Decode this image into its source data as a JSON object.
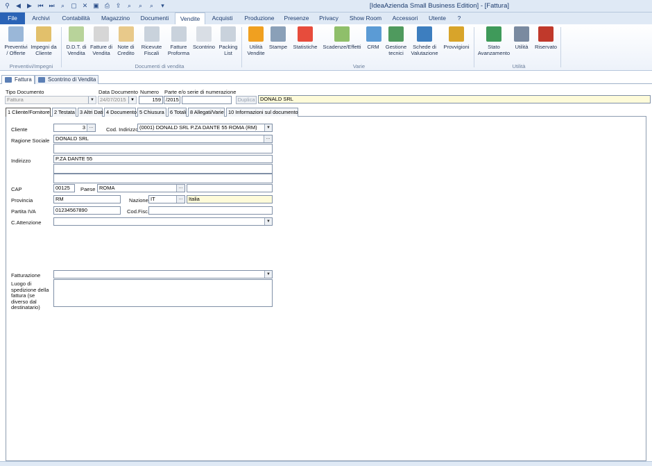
{
  "window": {
    "title": "[IdeaAzienda Small Business Edition] - [Fattura]"
  },
  "quick_access": [
    "binoculars-icon",
    "back-icon",
    "forward-icon",
    "first-icon",
    "last-icon",
    "search-icon",
    "new-icon",
    "delete-icon",
    "save-icon",
    "print-icon",
    "export-icon",
    "find-icon",
    "find-next-icon",
    "find-prev-icon",
    "customize-icon"
  ],
  "ribbon_tabs": [
    "File",
    "Archivi",
    "Contabilità",
    "Magazzino",
    "Documenti",
    "Vendite",
    "Acquisti",
    "Produzione",
    "Presenze",
    "Privacy",
    "Show Room",
    "Accessori",
    "Utente",
    "?"
  ],
  "ribbon": {
    "buttons": [
      {
        "label": "Preventivi\n/ Offerte",
        "icon": "quote-icon",
        "color": "#9ab7d8"
      },
      {
        "label": "Impegni da\nCliente",
        "icon": "commitment-icon",
        "color": "#e2c06b"
      },
      {
        "label": "D.D.T. di\nVendita",
        "icon": "delivery-note-icon",
        "color": "#b8d39a"
      },
      {
        "label": "Fatture di\nVendita",
        "icon": "invoice-icon",
        "color": "#d6d6d6"
      },
      {
        "label": "Note di\nCredito",
        "icon": "credit-note-icon",
        "color": "#e8c98a"
      },
      {
        "label": "Ricevute\nFiscali",
        "icon": "receipt-icon",
        "color": "#c9d2dc"
      },
      {
        "label": "Fatture\nProforma",
        "icon": "proforma-icon",
        "color": "#c9d2dc"
      },
      {
        "label": "Scontrino",
        "icon": "cash-receipt-icon",
        "color": "#d9dee5"
      },
      {
        "label": "Packing\nList",
        "icon": "packing-list-icon",
        "color": "#c9d2dc"
      },
      {
        "label": "Utilità\nVendite",
        "icon": "sales-tools-icon",
        "color": "#f0a020"
      },
      {
        "label": "Stampe",
        "icon": "printer-icon",
        "color": "#8aa0b8"
      },
      {
        "label": "Statistiche",
        "icon": "statistics-icon",
        "color": "#e74c3c"
      },
      {
        "label": "Scadenze/Effetti",
        "icon": "deadlines-icon",
        "color": "#8fbf6a"
      },
      {
        "label": "CRM",
        "icon": "crm-icon",
        "color": "#5b9bd5"
      },
      {
        "label": "Gestione\ntecnici",
        "icon": "technicians-icon",
        "color": "#4f9a5e"
      },
      {
        "label": "Schede di\nValutazione",
        "icon": "evaluation-icon",
        "color": "#3d7ebf"
      },
      {
        "label": "Provvigioni",
        "icon": "commissions-icon",
        "color": "#d8a42a"
      },
      {
        "label": "Stato\nAvanzamento",
        "icon": "progress-state-icon",
        "color": "#3f9a5a"
      },
      {
        "label": "Utilità",
        "icon": "tools-icon",
        "color": "#7a8aa0"
      },
      {
        "label": "Riservato",
        "icon": "reserved-icon",
        "color": "#c0392b"
      }
    ],
    "groups": [
      "Preventivi/Impegni",
      "Documenti di vendita",
      "Varie",
      "Utilità"
    ]
  },
  "document_tabs": [
    "Fattura",
    "Scontrino di Vendita"
  ],
  "header": {
    "tipo_documento_label": "Tipo Documento",
    "tipo_documento_value": "Fattura",
    "data_documento_label": "Data Documento",
    "data_documento_value": "24/07/2015",
    "numero_label": "Numero",
    "numero_value": "159",
    "parte_label": "Parte e/o serie di numerazione",
    "parte_value": "/2015",
    "duplica_label": "Duplica",
    "cliente_display": "DONALD SRL"
  },
  "section_tabs": [
    "1 Cliente/Fornitore",
    "2 Testata",
    "3 Altri Dati",
    "4 Documento",
    "5 Chiusura",
    "6 Totali",
    "8 Allegati/Varie",
    "10 Informazioni sul documento"
  ],
  "form": {
    "cliente_label": "Cliente",
    "cliente_value": "3",
    "cod_indirizzo_label": "Cod. Indirizzo",
    "cod_indirizzo_value": "(0001) DONALD SRL P.ZA DANTE 55 ROMA (RM)",
    "ragione_sociale_label": "Ragione Sociale",
    "ragione_sociale_value": "DONALD SRL",
    "indirizzo_label": "Indirizzo",
    "indirizzo_value": "P.ZA DANTE 55",
    "cap_label": "CAP",
    "cap_value": "00125",
    "paese_label": "Paese",
    "paese_value": "ROMA",
    "provincia_label": "Provincia",
    "provincia_value": "RM",
    "nazione_label": "Nazione",
    "nazione_value": "IT",
    "nazione_desc": "Italia",
    "partita_iva_label": "Partita IVA",
    "partita_iva_value": "01234567890",
    "cod_fisc_label": "Cod.Fisc.",
    "attenzione_label": "C.Attenzione",
    "fatturazione_label": "Fatturazione",
    "luogo_label": "Luogo di spedizione della fattura (se diverso dal destinatario)"
  }
}
